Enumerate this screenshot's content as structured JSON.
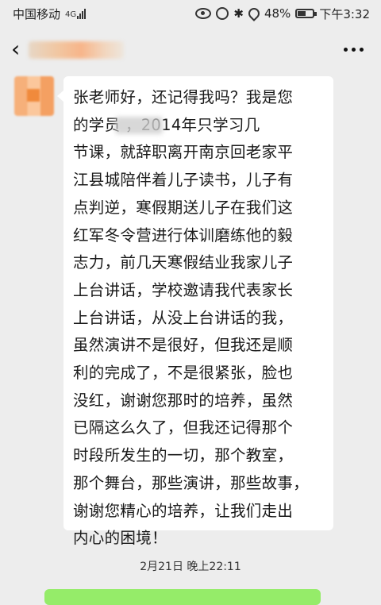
{
  "status_bar": {
    "carrier": "中国移动",
    "network": "4G",
    "battery": "48%",
    "time": "下午3:32"
  },
  "header": {
    "back_icon": "chevron-left-icon",
    "more_icon": "more-dots-icon"
  },
  "chat": {
    "message_lines": [
      "张老师好，还记得我吗？我是您",
      "的学员        ，2014年只学习几",
      "节课，就辞职离开南京回老家平",
      "江县城陪伴着儿子读书，儿子有",
      "点判逆，寒假期送儿子在我们这",
      "红军冬令营进行体训磨练他的毅",
      "志力，前几天寒假结业我家儿子",
      "上台讲话，学校邀请我代表家长",
      "上台讲话，从没上台讲话的我，",
      "虽然演讲不是很好，但我还是顺",
      "利的完成了，不是很紧张，脸也",
      "没红，谢谢您那时的培养，虽然",
      "已隔这么久了，但我还记得那个",
      "时段所发生的一切，那个教室，",
      "那个舞台，那些演讲，那些故事，",
      "谢谢您精心的培养，让我们走出",
      "内心的困境！"
    ],
    "timestamp": "2月21日 晚上22:11"
  }
}
